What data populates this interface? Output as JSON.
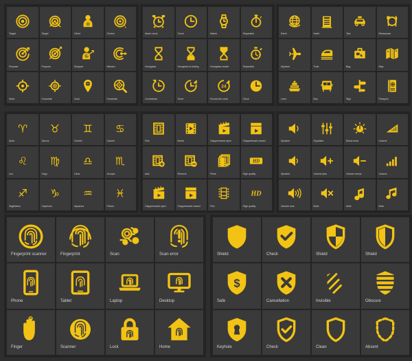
{
  "theme": {
    "background": "#2e2e2e",
    "panel_background": "#242424",
    "tile_background": "#3a3a3a",
    "icon_color": "#f2c314",
    "label_color": "#d6d6d6"
  },
  "groups": [
    {
      "id": "target",
      "name": "target-and-goal-icons",
      "size": "small",
      "tiles": [
        {
          "icon": "target-rings-icon",
          "label": "Target"
        },
        {
          "icon": "target-rings-darts-icon",
          "label": "Target"
        },
        {
          "icon": "client-person-target-icon",
          "label": "Client"
        },
        {
          "icon": "target-cursor-icon",
          "label": "Choice"
        },
        {
          "icon": "target-arrow-icon",
          "label": "Purpose"
        },
        {
          "icon": "target-arrow-darts-icon",
          "label": "Purpose"
        },
        {
          "icon": "shopper-person-icon",
          "label": "Shopper"
        },
        {
          "icon": "target-side-arrow-icon",
          "label": "Mission"
        },
        {
          "icon": "crosshair-dot-icon",
          "label": "Work"
        },
        {
          "icon": "crosshair-icon",
          "label": "Crosshair"
        },
        {
          "icon": "goal-pin-icon",
          "label": "Goal"
        },
        {
          "icon": "crosshair-magnifier-icon",
          "label": "Crosshair"
        }
      ]
    },
    {
      "id": "time",
      "name": "time-and-clock-icons",
      "size": "small",
      "tiles": [
        {
          "icon": "alarm-clock-icon",
          "label": "Alarm clock"
        },
        {
          "icon": "clock-icon",
          "label": "Clock"
        },
        {
          "icon": "watch-icon",
          "label": "Watch"
        },
        {
          "icon": "stopwatch-icon",
          "label": "Stopwatch"
        },
        {
          "icon": "hourglass-icon",
          "label": "Hourglass"
        },
        {
          "icon": "hourglass-ticking-icon",
          "label": "Hourglass is ticking"
        },
        {
          "icon": "hourglass-ended-icon",
          "label": "Hourglass ended"
        },
        {
          "icon": "stopwatch-dial-icon",
          "label": "Stopwatch"
        },
        {
          "icon": "countdown-icon",
          "label": "Countdown"
        },
        {
          "icon": "timer-icon",
          "label": "Timer"
        },
        {
          "icon": "round-the-clock-icon",
          "label": "Round-the-clock"
        },
        {
          "icon": "clock-filled-icon",
          "label": "Clock"
        }
      ]
    },
    {
      "id": "travel",
      "name": "travel-icons",
      "size": "small",
      "tiles": [
        {
          "icon": "earth-globe-icon",
          "label": "Earth"
        },
        {
          "icon": "hotel-icon",
          "label": "Hotel"
        },
        {
          "icon": "taxi-icon",
          "label": "Taxi"
        },
        {
          "icon": "restaurant-icon",
          "label": "Restaurant"
        },
        {
          "icon": "airplane-icon",
          "label": "Airplane"
        },
        {
          "icon": "train-icon",
          "label": "Train"
        },
        {
          "icon": "bag-icon",
          "label": "Bag"
        },
        {
          "icon": "map-icon",
          "label": "Map"
        },
        {
          "icon": "liner-ship-icon",
          "label": "Liner"
        },
        {
          "icon": "bus-icon",
          "label": "Bus"
        },
        {
          "icon": "sign-post-icon",
          "label": "Sign"
        },
        {
          "icon": "passport-icon",
          "label": "Passport"
        }
      ]
    },
    {
      "id": "zodiac",
      "name": "zodiac-sign-icons",
      "size": "small",
      "tiles": [
        {
          "icon": "aries-icon",
          "label": "Aries",
          "glyph": "♈"
        },
        {
          "icon": "taurus-icon",
          "label": "Taurus",
          "glyph": "♉"
        },
        {
          "icon": "gemini-icon",
          "label": "Gemini",
          "glyph": "♊"
        },
        {
          "icon": "cancer-icon",
          "label": "Cancer",
          "glyph": "♋"
        },
        {
          "icon": "leo-icon",
          "label": "Leo",
          "glyph": "♌"
        },
        {
          "icon": "virgo-icon",
          "label": "Virgo",
          "glyph": "♍"
        },
        {
          "icon": "libra-icon",
          "label": "Libra",
          "glyph": "♎"
        },
        {
          "icon": "scorpio-icon",
          "label": "Scorpio",
          "glyph": "♏"
        },
        {
          "icon": "sagittarius-icon",
          "label": "Sagittarius",
          "glyph": "♐"
        },
        {
          "icon": "capricorn-icon",
          "label": "Capricorn",
          "glyph": "♑"
        },
        {
          "icon": "aquarius-icon",
          "label": "Aquarius",
          "glyph": "♒"
        },
        {
          "icon": "pisces-icon",
          "label": "Pisces",
          "glyph": "♓"
        }
      ]
    },
    {
      "id": "cinema",
      "name": "cinema-and-film-icons",
      "size": "small",
      "tiles": [
        {
          "icon": "film-strip-icon",
          "label": "Film"
        },
        {
          "icon": "movie-play-icon",
          "label": "Movie"
        },
        {
          "icon": "clapperboard-open-icon",
          "label": "Clapperboard open"
        },
        {
          "icon": "clapperboard-closed-icon",
          "label": "Clapperboard closed"
        },
        {
          "icon": "film-add-icon",
          "label": "Add"
        },
        {
          "icon": "film-remove-icon",
          "label": "Remove"
        },
        {
          "icon": "films-stack-icon",
          "label": "Films"
        },
        {
          "icon": "hd-badge-icon",
          "label": "High quality",
          "text": "HD"
        },
        {
          "icon": "clapperboard-open-play-icon",
          "label": "Clapperboard open"
        },
        {
          "icon": "clapperboard-closed-play-icon",
          "label": "Clapperboard closed"
        },
        {
          "icon": "film-vertical-icon",
          "label": "Film"
        },
        {
          "icon": "hd-text-icon",
          "label": "High quality",
          "text": "HD"
        }
      ]
    },
    {
      "id": "audio",
      "name": "audio-and-volume-icons",
      "size": "small",
      "tiles": [
        {
          "icon": "speaker-icon",
          "label": "Speaker"
        },
        {
          "icon": "equalizer-icon",
          "label": "Equalizer"
        },
        {
          "icon": "music-knob-icon",
          "label": "Music knob"
        },
        {
          "icon": "volume-wedge-icon",
          "label": "Volume"
        },
        {
          "icon": "speaker-wave-icon",
          "label": "Speaker"
        },
        {
          "icon": "volume-plus-icon",
          "label": "Volume plus"
        },
        {
          "icon": "volume-minus-icon",
          "label": "Volume minus"
        },
        {
          "icon": "volume-bars-icon",
          "label": "Volume"
        },
        {
          "icon": "volume-max-icon",
          "label": "Volume max"
        },
        {
          "icon": "mute-icon",
          "label": "Mute"
        },
        {
          "icon": "music-note-icon",
          "label": "Note"
        },
        {
          "icon": "music-notes-icon",
          "label": "Note"
        }
      ]
    },
    {
      "id": "fingerprint",
      "name": "fingerprint-and-biometric-icons",
      "size": "big",
      "tiles": [
        {
          "icon": "fingerprint-scanner-icon",
          "label": "Fingerprint scanner"
        },
        {
          "icon": "fingerprint-icon",
          "label": "Fingerprint"
        },
        {
          "icon": "scan-icon",
          "label": "Scan"
        },
        {
          "icon": "scan-error-icon",
          "label": "Scan error"
        },
        {
          "icon": "phone-fingerprint-icon",
          "label": "Phone"
        },
        {
          "icon": "tablet-fingerprint-icon",
          "label": "Tablet"
        },
        {
          "icon": "laptop-fingerprint-icon",
          "label": "Laptop"
        },
        {
          "icon": "desktop-fingerprint-icon",
          "label": "Desktop"
        },
        {
          "icon": "hand-finger-icon",
          "label": "Finger"
        },
        {
          "icon": "scanner-circle-icon",
          "label": "Scanner"
        },
        {
          "icon": "lock-fingerprint-icon",
          "label": "Lock"
        },
        {
          "icon": "home-fingerprint-icon",
          "label": "Home"
        }
      ]
    },
    {
      "id": "shield",
      "name": "shield-and-security-icons",
      "size": "big",
      "tiles": [
        {
          "icon": "shield-solid-icon",
          "label": "Shield"
        },
        {
          "icon": "shield-check-icon",
          "label": "Check"
        },
        {
          "icon": "shield-quarter-icon",
          "label": "Shield"
        },
        {
          "icon": "shield-half-icon",
          "label": "Shield"
        },
        {
          "icon": "shield-dollar-icon",
          "label": "Safe"
        },
        {
          "icon": "shield-cross-icon",
          "label": "Cancellation"
        },
        {
          "icon": "shield-striped-icon",
          "label": "Invisible"
        },
        {
          "icon": "shield-bars-icon",
          "label": "Obscure"
        },
        {
          "icon": "shield-keyhole-icon",
          "label": "Keyhole"
        },
        {
          "icon": "shield-outline-check-icon",
          "label": "Check"
        },
        {
          "icon": "shield-outline-icon",
          "label": "Clean"
        },
        {
          "icon": "shield-dashed-icon",
          "label": "Absent"
        }
      ]
    }
  ]
}
